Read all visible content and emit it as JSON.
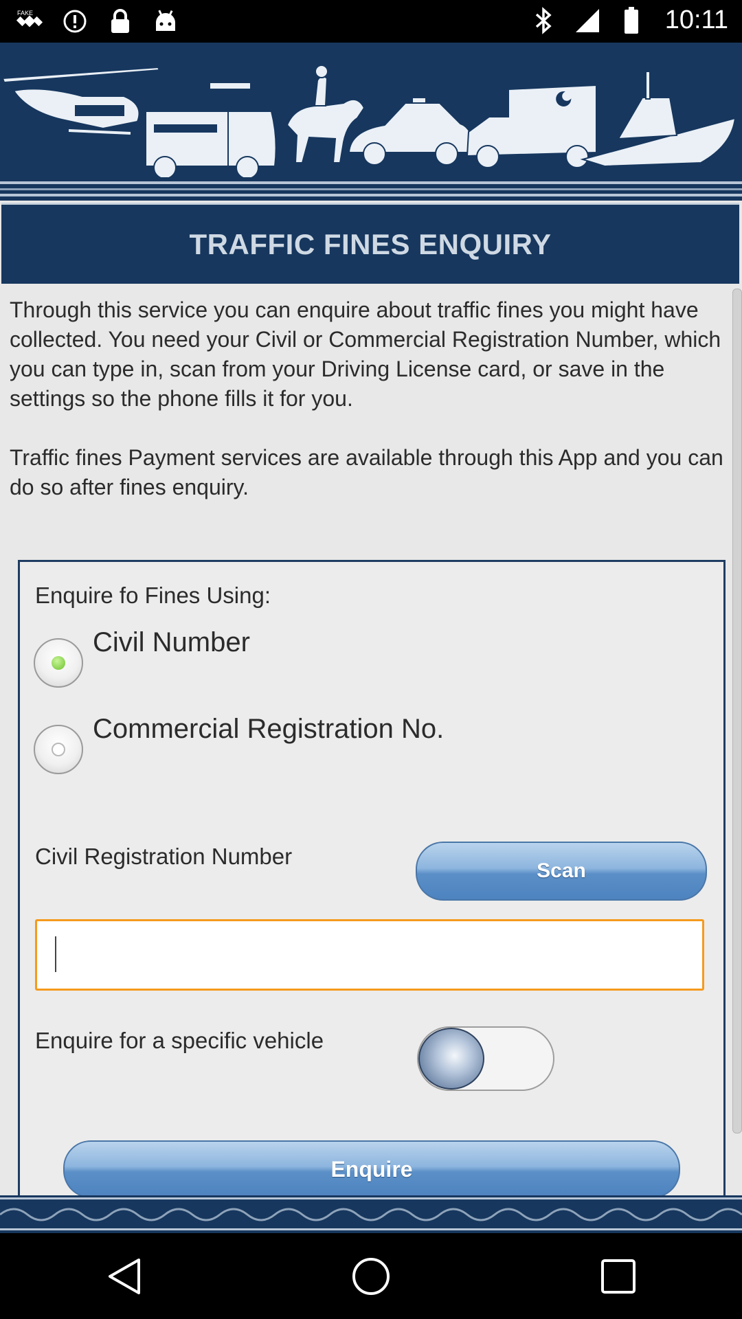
{
  "status_bar": {
    "time": "10:11",
    "left_icons": [
      "fake-gps-icon",
      "alert-icon",
      "lock-icon",
      "android-icon"
    ],
    "right_icons": [
      "bluetooth-icon",
      "signal-icon",
      "battery-icon"
    ]
  },
  "header": {
    "title": "TRAFFIC FINES ENQUIRY"
  },
  "intro": {
    "paragraph_1": "Through this service you can enquire about traffic fines you might have collected. You need your Civil or Commercial Registration Number, which you can type in, scan from your Driving License card, or save in the settings so the phone fills it for you.",
    "paragraph_2": "Traffic fines Payment services are available through this App and you can do so after fines enquiry."
  },
  "form": {
    "enquire_using_label": "Enquire fo Fines Using:",
    "options": [
      {
        "label": "Civil Number",
        "selected": true
      },
      {
        "label": "Commercial Registration No.",
        "selected": false
      }
    ],
    "reg_number_label": "Civil Registration Number",
    "scan_button": "Scan",
    "reg_number_value": "",
    "specific_vehicle_label": "Enquire for a specific vehicle",
    "specific_vehicle_on": false,
    "enquire_button": "Enquire"
  },
  "colors": {
    "banner": "#17375e",
    "accent_orange": "#f59a1c",
    "button_blue": "#5b8fc7",
    "radio_selected": "#6cc22c"
  },
  "nav_bar": {
    "buttons": [
      "back-icon",
      "home-icon",
      "recents-icon"
    ]
  }
}
